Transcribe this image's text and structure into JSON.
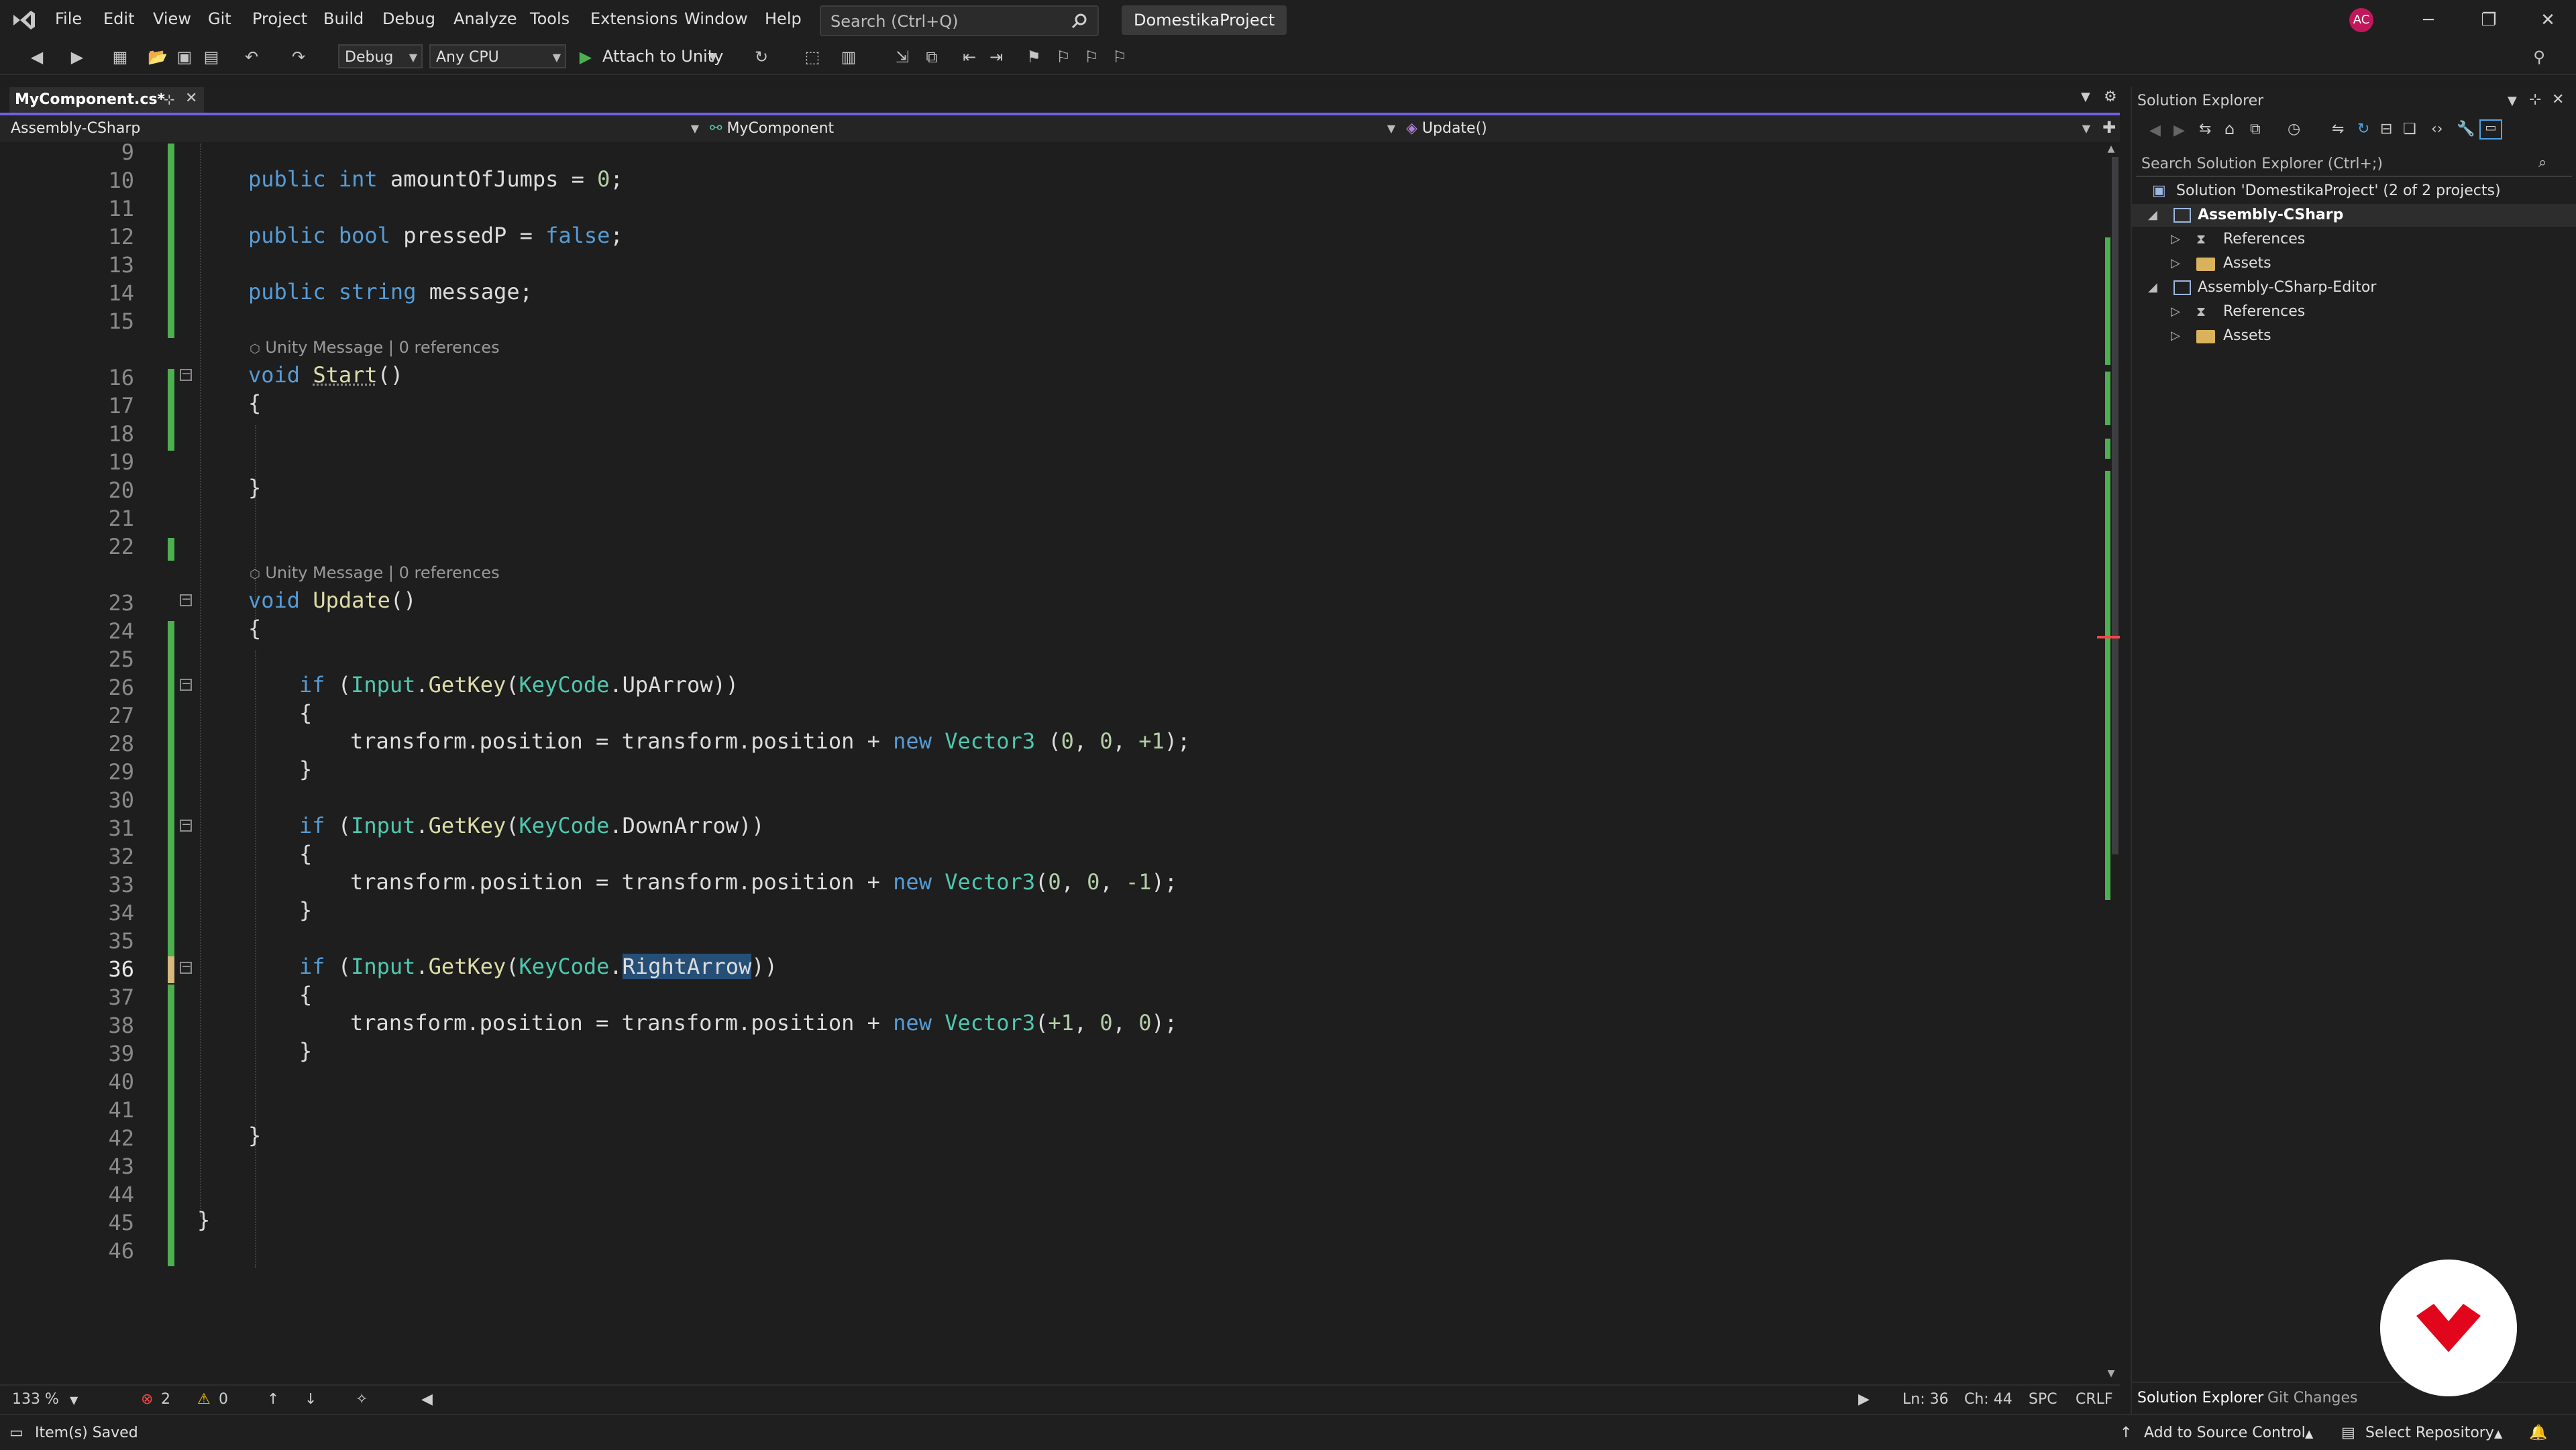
{
  "menu": [
    "File",
    "Edit",
    "View",
    "Git",
    "Project",
    "Build",
    "Debug",
    "Analyze",
    "Tools",
    "Extensions",
    "Window",
    "Help"
  ],
  "search": {
    "placeholder": "Search (Ctrl+Q)"
  },
  "project_name": "DomestikaProject",
  "user_initials": "AC",
  "toolbar": {
    "config": "Debug",
    "platform": "Any CPU",
    "attach_label": "Attach to Unity"
  },
  "doc_tab": {
    "label": "MyComponent.cs*"
  },
  "navbar": {
    "project": "Assembly-CSharp",
    "class": "MyComponent",
    "member": "Update()"
  },
  "codelens": {
    "text": "Unity Message | 0 references"
  },
  "editor": {
    "line_numbers": [
      "9",
      "10",
      "11",
      "12",
      "13",
      "14",
      "15",
      "16",
      "17",
      "18",
      "19",
      "20",
      "21",
      "22",
      "23",
      "24",
      "25",
      "26",
      "27",
      "28",
      "29",
      "30",
      "31",
      "32",
      "33",
      "34",
      "35",
      "36",
      "37",
      "38",
      "39",
      "40",
      "41",
      "42",
      "43",
      "44",
      "45",
      "46"
    ],
    "active_line": "36"
  },
  "editor_status": {
    "zoom": "133 %",
    "errors": "2",
    "warnings": "0",
    "position": "Ln: 36",
    "column": "Ch: 44",
    "indent": "SPC",
    "eol": "CRLF"
  },
  "solution_explorer": {
    "title": "Solution Explorer",
    "search_placeholder": "Search Solution Explorer (Ctrl+;)",
    "solution": "Solution 'DomestikaProject' (2 of 2 projects)",
    "projects": [
      {
        "name": "Assembly-CSharp",
        "children": [
          "References",
          "Assets"
        ]
      },
      {
        "name": "Assembly-CSharp-Editor",
        "children": [
          "References",
          "Assets"
        ]
      }
    ],
    "tabs": [
      "Solution Explorer",
      "Git Changes"
    ]
  },
  "statusbar": {
    "message": "Item(s) Saved",
    "source_control": "Add to Source Control",
    "repository": "Select Repository"
  },
  "colors": {
    "accent": "#7160e8",
    "keyword": "#569cd6",
    "type": "#4ec9b0",
    "method": "#dcdcaa",
    "number": "#b5cea8",
    "change_bar": "#4caf50",
    "logo_red": "#e1061c"
  }
}
